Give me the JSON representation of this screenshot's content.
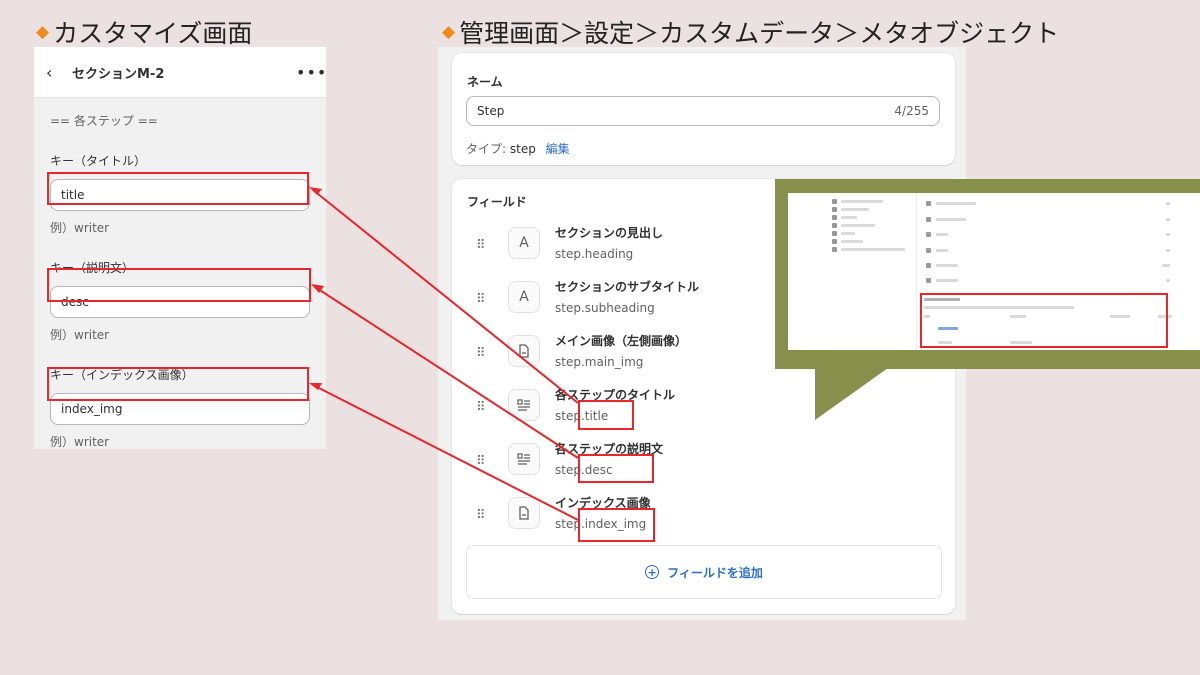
{
  "headings": {
    "left": "カスタマイズ画面",
    "right": "管理画面＞設定＞カスタムデータ＞メタオブジェクト"
  },
  "customize_panel": {
    "back_icon": "chevron-left-icon",
    "title": "セクションM-2",
    "more_icon": "ellipsis-icon",
    "separator": "== 各ステップ ==",
    "groups": [
      {
        "label": "キー（タイトル）",
        "value": "title",
        "hint": "例）writer"
      },
      {
        "label": "キー（説明文）",
        "value": "desc",
        "hint": "例）writer"
      },
      {
        "label": "キー（インデックス画像）",
        "value": "index_img",
        "hint": "例）writer"
      }
    ]
  },
  "metaobject": {
    "name_card": {
      "title": "ネーム",
      "input_value": "Step",
      "char_count": "4/255",
      "type_label": "タイプ:",
      "type_value": "step",
      "edit_link": "編集"
    },
    "fields_card": {
      "title": "フィールド",
      "fields": [
        {
          "name": "セクションの見出し",
          "key": "step.heading",
          "icon": "text-A-icon"
        },
        {
          "name": "セクションのサブタイトル",
          "key": "step.subheading",
          "icon": "text-A-icon"
        },
        {
          "name": "メイン画像（左側画像）",
          "key": "step.main_img",
          "icon": "file-icon"
        },
        {
          "name": "各ステップのタイトル",
          "key": "step.title",
          "icon": "text-block-icon"
        },
        {
          "name": "各ステップの説明文",
          "key": "step.desc",
          "icon": "text-block-icon"
        },
        {
          "name": "インデックス画像",
          "key": "step.index_img",
          "icon": "file-icon"
        }
      ],
      "add_button": "フィールドを追加",
      "add_icon": "plus-circle-icon"
    }
  },
  "colors": {
    "background": "#ebe1e1",
    "accent_diamond": "#f08a1c",
    "highlight_red": "#e8262b",
    "link_blue": "#2b6dd0",
    "callout_olive": "#87904a"
  }
}
